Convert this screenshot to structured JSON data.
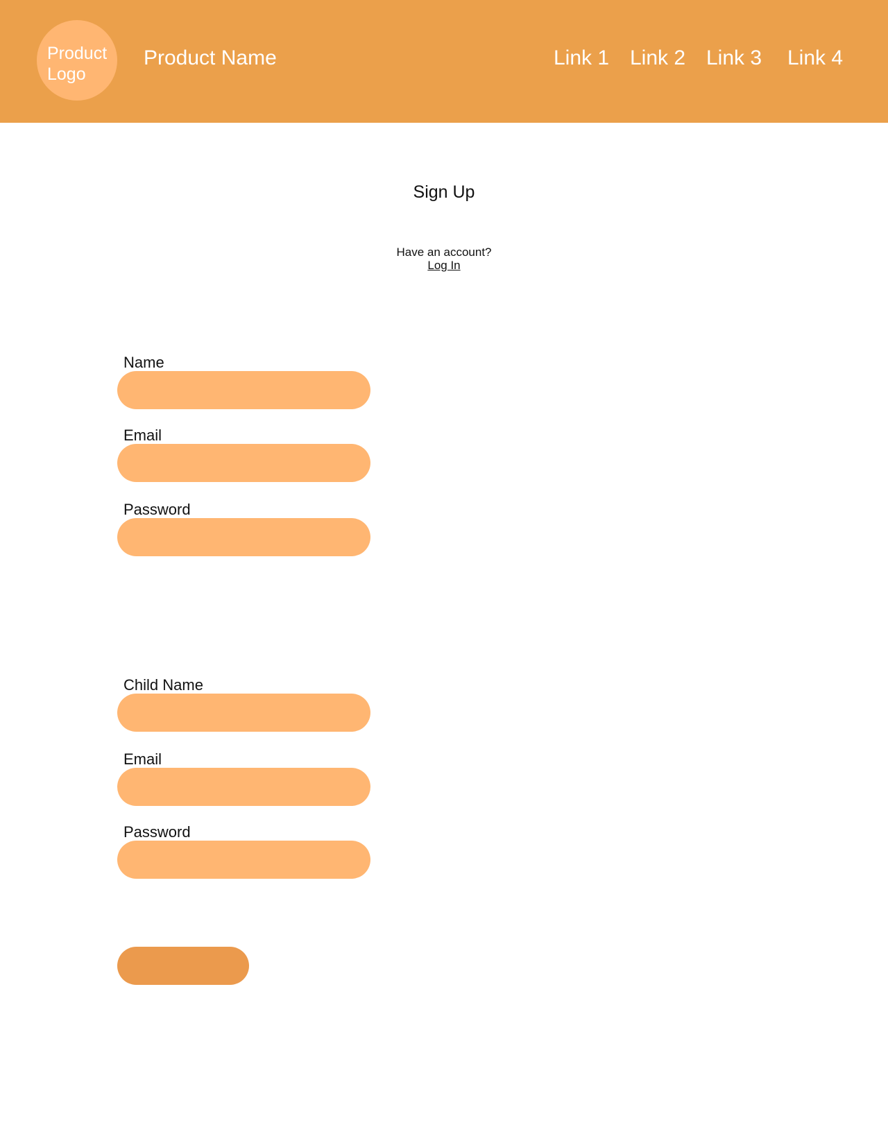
{
  "header": {
    "logo_text": "Product Logo",
    "product_name": "Product Name",
    "links": [
      "Link 1",
      "Link 2",
      "Link 3",
      "Link 4"
    ]
  },
  "title": "Sign Up",
  "account_prompt": "Have an account?",
  "login_link": "Log In",
  "parent_form": {
    "name_label": "Name",
    "email_label": "Email",
    "password_label": "Password"
  },
  "child_form": {
    "name_label": "Child Name",
    "email_label": "Email",
    "password_label": "Password"
  },
  "submit_label": "",
  "colors": {
    "header": "#eba04b",
    "logo": "#ffb672",
    "input": "#ffb672",
    "button": "#eb9a4d"
  }
}
